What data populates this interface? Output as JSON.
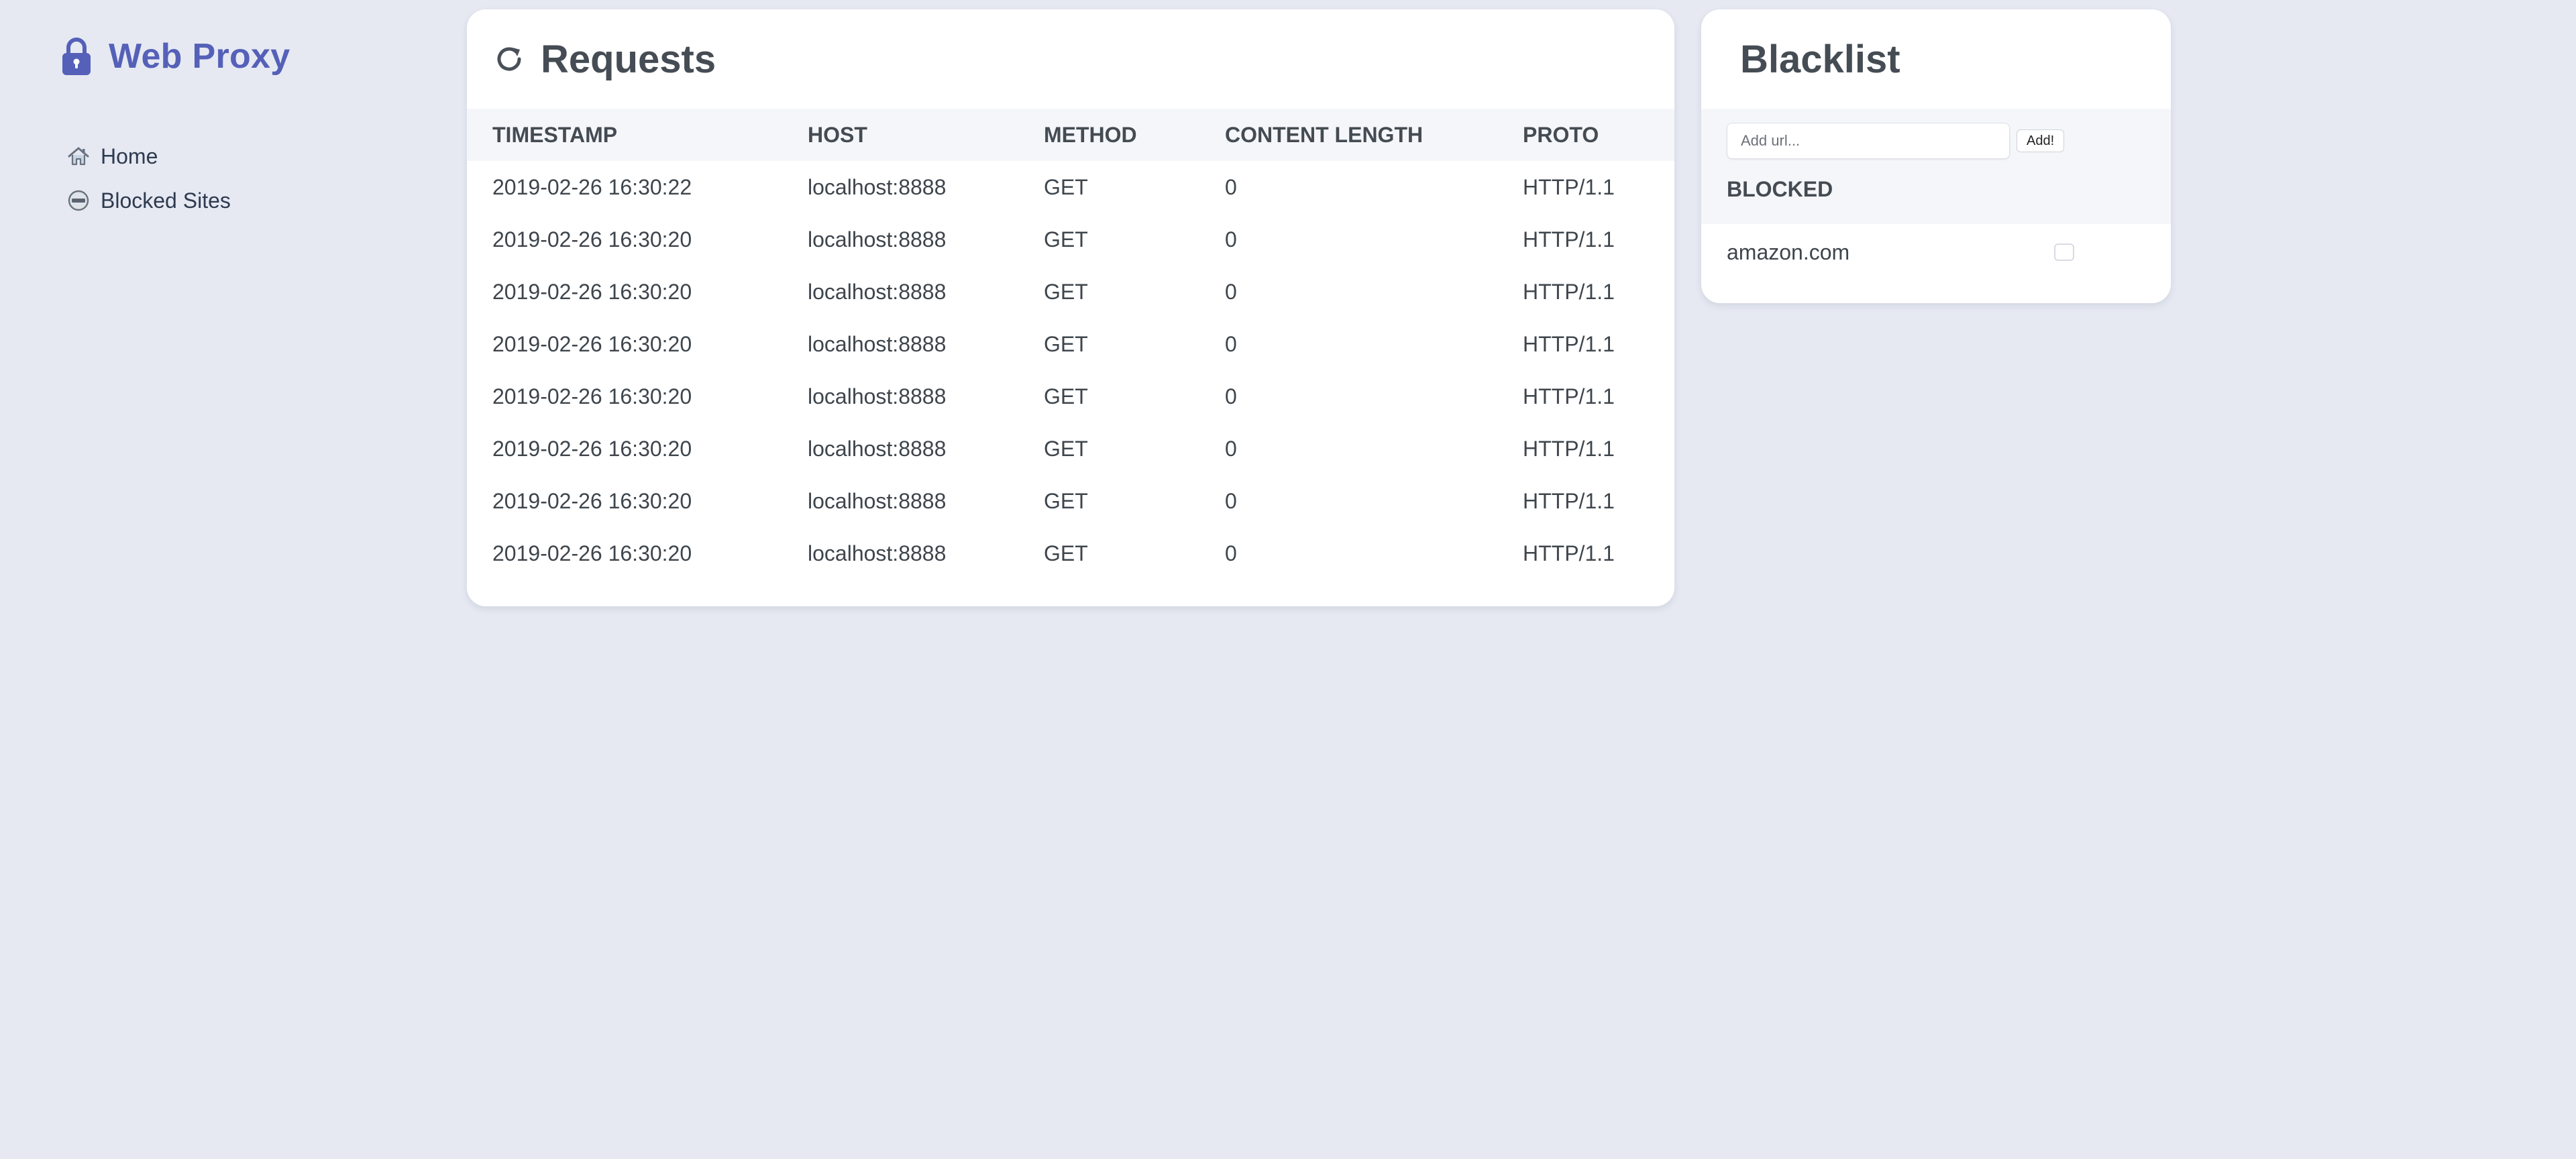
{
  "brand": {
    "title": "Web Proxy",
    "color": "#5560b8",
    "icon": "lock-icon"
  },
  "nav": {
    "items": [
      {
        "label": "Home",
        "icon": "home-icon"
      },
      {
        "label": "Blocked Sites",
        "icon": "blocked-sites-icon"
      }
    ]
  },
  "requests": {
    "title": "Requests",
    "refresh_icon": "refresh-icon",
    "columns": [
      "TIMESTAMP",
      "HOST",
      "METHOD",
      "CONTENT LENGTH",
      "PROTO"
    ],
    "rows": [
      [
        "2019-02-26 16:30:22",
        "localhost:8888",
        "GET",
        "0",
        "HTTP/1.1"
      ],
      [
        "2019-02-26 16:30:20",
        "localhost:8888",
        "GET",
        "0",
        "HTTP/1.1"
      ],
      [
        "2019-02-26 16:30:20",
        "localhost:8888",
        "GET",
        "0",
        "HTTP/1.1"
      ],
      [
        "2019-02-26 16:30:20",
        "localhost:8888",
        "GET",
        "0",
        "HTTP/1.1"
      ],
      [
        "2019-02-26 16:30:20",
        "localhost:8888",
        "GET",
        "0",
        "HTTP/1.1"
      ],
      [
        "2019-02-26 16:30:20",
        "localhost:8888",
        "GET",
        "0",
        "HTTP/1.1"
      ],
      [
        "2019-02-26 16:30:20",
        "localhost:8888",
        "GET",
        "0",
        "HTTP/1.1"
      ],
      [
        "2019-02-26 16:30:20",
        "localhost:8888",
        "GET",
        "0",
        "HTTP/1.1"
      ]
    ]
  },
  "blacklist": {
    "title": "Blacklist",
    "input_placeholder": "Add url...",
    "input_value": "",
    "add_label": "Add!",
    "blocked_heading": "BLOCKED",
    "sites": [
      {
        "url": "amazon.com",
        "checked": false
      }
    ]
  },
  "colors": {
    "background": "#e6e9f2",
    "card": "#ffffff",
    "accent": "#5560b8",
    "header_band": "#f5f6fa"
  }
}
